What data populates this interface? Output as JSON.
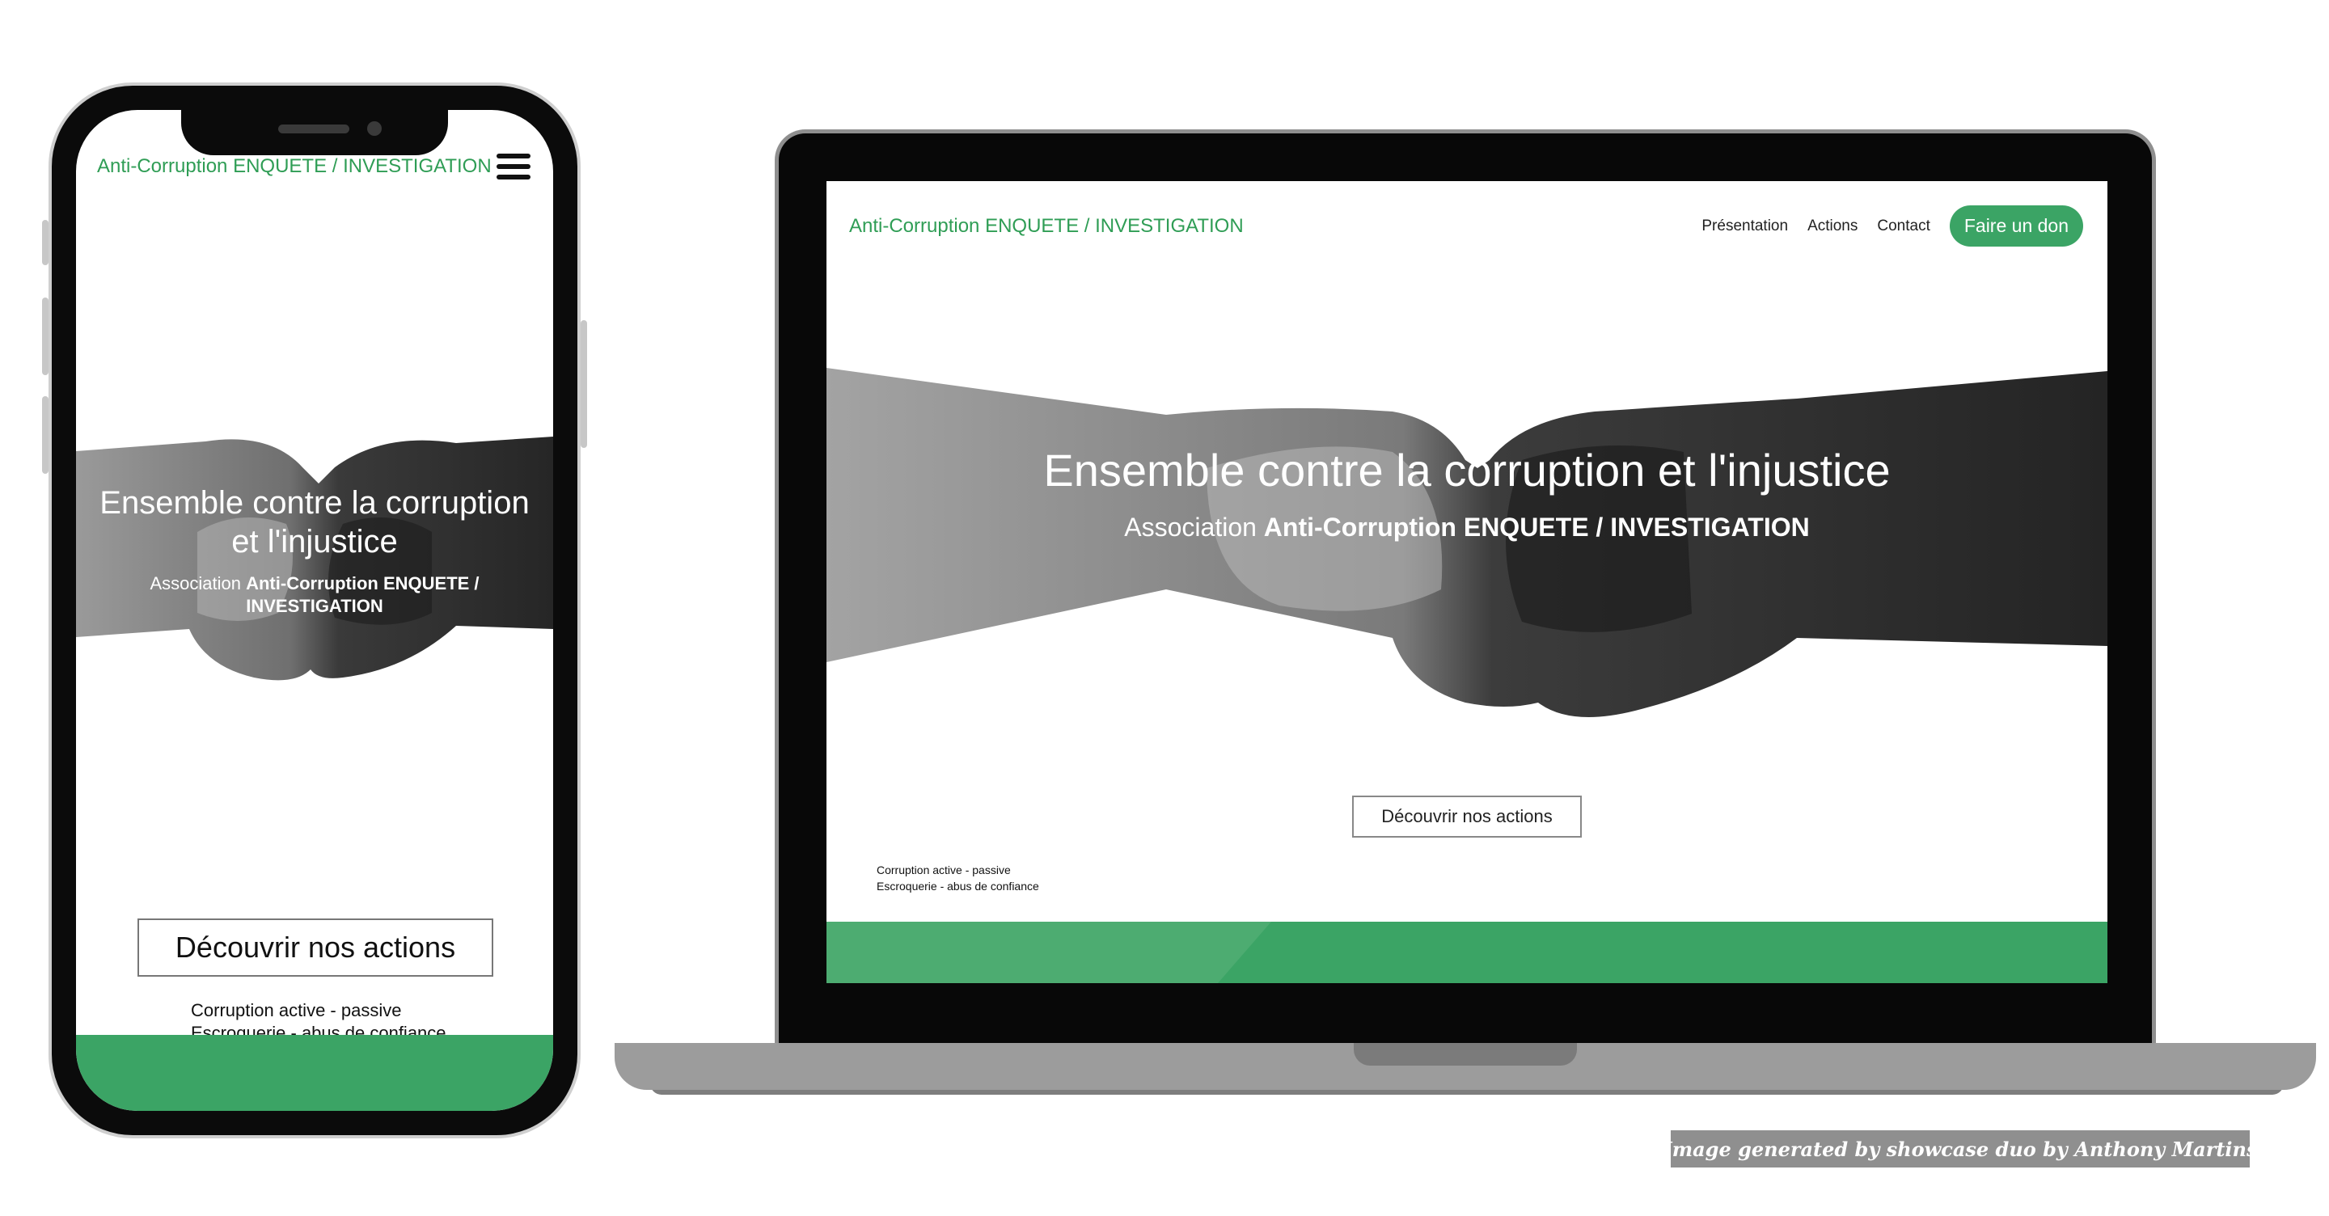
{
  "brand": {
    "name": "Anti-Corruption ENQUETE / INVESTIGATION",
    "accent": "#3ba465"
  },
  "hero": {
    "title": "Ensemble contre la corruption et l'injustice",
    "subtitle_prefix": "Association",
    "subtitle_strong": "Anti-Corruption ENQUETE / INVESTIGATION"
  },
  "nav": {
    "links": [
      "Présentation",
      "Actions",
      "Contact"
    ],
    "donate": "Faire un don"
  },
  "cta": {
    "label": "Découvrir nos actions"
  },
  "tags": [
    "Corruption active - passive",
    "Escroquerie - abus de confiance"
  ],
  "mobile": {
    "menu_icon": "hamburger-icon"
  },
  "credit": "Image generated by showcase duo by Anthony Martins"
}
